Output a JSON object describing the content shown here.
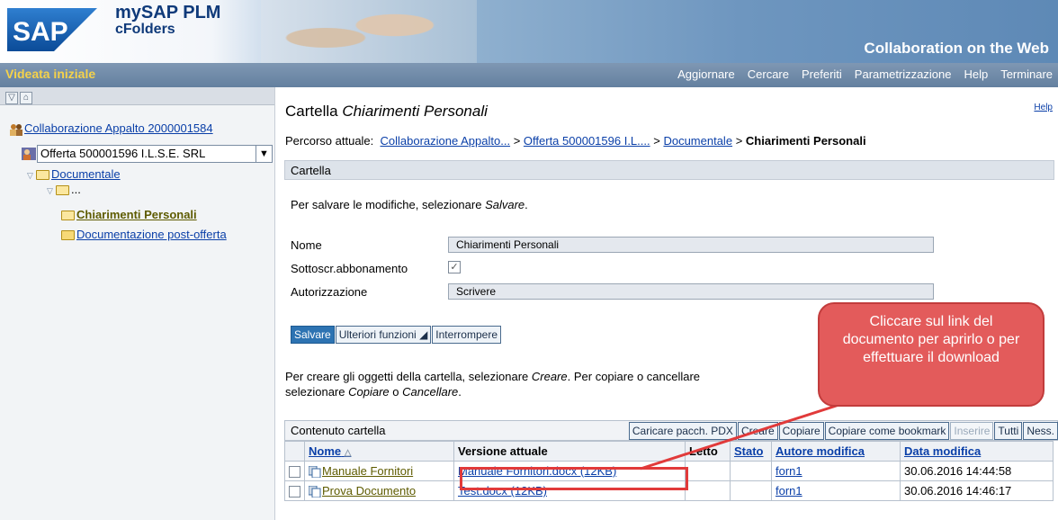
{
  "header": {
    "logo_text": "SAP",
    "product_name": "mySAP PLM",
    "product_sub": "cFolders",
    "tagline": "Collaboration on the Web"
  },
  "navbar": {
    "title": "Videata iniziale",
    "menu": [
      "Aggiornare",
      "Cercare",
      "Preferiti",
      "Parametrizzazione",
      "Help",
      "Terminare"
    ]
  },
  "sidebar": {
    "collaboration": "Collaborazione Appalto 2000001584",
    "offer_select": "Offerta 500001596 I.L.S.E. SRL",
    "folders": {
      "documentale": "Documentale",
      "ellipsis": "...",
      "chiarimenti": "Chiarimenti Personali",
      "post_offerta": "Documentazione post-offerta"
    }
  },
  "main": {
    "title_prefix": "Cartella ",
    "title_name": "Chiarimenti Personali",
    "help": "Help",
    "breadcrumb": {
      "label": "Percorso attuale:",
      "items": [
        "Collaborazione Appalto...",
        "Offerta 500001596 I.L....",
        "Documentale"
      ],
      "separator": ">",
      "current": "Chiarimenti Personali"
    },
    "section_title": "Cartella",
    "info_text_prefix": "Per salvare le modifiche, selezionare ",
    "info_text_em": "Salvare",
    "info_text_suffix": ".",
    "form": {
      "name_label": "Nome",
      "name_value": "Chiarimenti Personali",
      "subscription_label": "Sottoscr.abbonamento",
      "subscription_checked": true,
      "authorization_label": "Autorizzazione",
      "authorization_value": "Scrivere"
    },
    "buttons": {
      "save": "Salvare",
      "more": "Ulteriori funzioni",
      "cancel": "Interrompere"
    },
    "create_text": {
      "line1_a": "Per creare gli oggetti della cartella, selezionare ",
      "line1_em": "Creare",
      "line1_b": ". Per copiare o cancellare",
      "line2_a": "selezionare ",
      "line2_em1": "Copiare",
      "line2_b": " o ",
      "line2_em2": "Cancellare",
      "line2_c": "."
    },
    "table": {
      "title": "Contenuto cartella",
      "toolbar": [
        "Caricare pacch. PDX",
        "Creare",
        "Copiare",
        "Copiare come bookmark",
        "Inserire",
        "Tutti",
        "Ness."
      ],
      "columns": [
        "Nome",
        "Versione attuale",
        "Letto",
        "Stato",
        "Autore modifica",
        "Data modifica"
      ],
      "rows": [
        {
          "name": "Manuale Fornitori",
          "version": "Manuale Fornitori.docx (12KB)",
          "read": "",
          "status": "",
          "author": "forn1",
          "date": "30.06.2016 14:44:58"
        },
        {
          "name": "Prova Documento",
          "version": "Test.docx (12KB)",
          "read": "",
          "status": "",
          "author": "forn1",
          "date": "30.06.2016 14:46:17"
        }
      ]
    }
  },
  "callout": {
    "text": "Cliccare sul link del documento per aprirlo o per effettuare il download"
  },
  "colors": {
    "nav_title": "#f5d24a",
    "link": "#0a3fa8",
    "callout": "#e35b5b",
    "primary_button": "#2d73b2"
  }
}
